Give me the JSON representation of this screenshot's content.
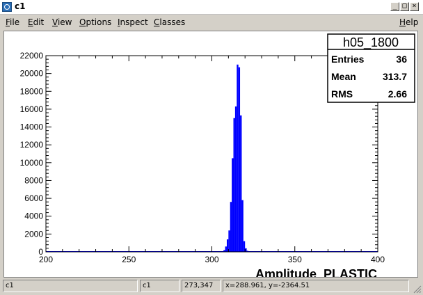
{
  "window": {
    "title": "c1",
    "buttons": {
      "minimize": "_",
      "maximize": "□",
      "close": "×"
    }
  },
  "menu": {
    "items": [
      {
        "label": "File",
        "underline": "F",
        "rest": "ile"
      },
      {
        "label": "Edit",
        "underline": "E",
        "rest": "dit"
      },
      {
        "label": "View",
        "underline": "V",
        "rest": "iew"
      },
      {
        "label": "Options",
        "underline": "O",
        "rest": "ptions"
      },
      {
        "label": "Inspect",
        "underline": "I",
        "rest": "nspect"
      },
      {
        "label": "Classes",
        "underline": "C",
        "rest": "lasses"
      }
    ],
    "help": {
      "label": "Help",
      "underline": "H",
      "rest": "elp"
    }
  },
  "stats": {
    "name": "h05_1800",
    "rows": [
      {
        "label": "Entries",
        "value": "36"
      },
      {
        "label": "Mean",
        "value": "313.7"
      },
      {
        "label": "RMS",
        "value": "2.66"
      }
    ]
  },
  "chart_data": {
    "type": "bar",
    "xlabel": "Amplitude_PLASTIC",
    "xlim": [
      200,
      400
    ],
    "ylim": [
      0,
      22000
    ],
    "xticks": [
      200,
      250,
      300,
      350,
      400
    ],
    "yticks": [
      0,
      2000,
      4000,
      6000,
      8000,
      10000,
      12000,
      14000,
      16000,
      18000,
      20000,
      22000
    ],
    "bin_width": 1,
    "bins_x": [
      307,
      308,
      309,
      310,
      311,
      312,
      313,
      314,
      315,
      316,
      317,
      318,
      319,
      320,
      321
    ],
    "bins_y": [
      200,
      600,
      1400,
      2400,
      5600,
      10500,
      15000,
      16300,
      21000,
      20700,
      15300,
      5800,
      1200,
      400,
      120
    ],
    "fill_color": "#0000ff",
    "grid": false
  },
  "status": {
    "cells": [
      "c1",
      "c1",
      "273,347",
      "x=288.961, y=-2364.51"
    ]
  }
}
